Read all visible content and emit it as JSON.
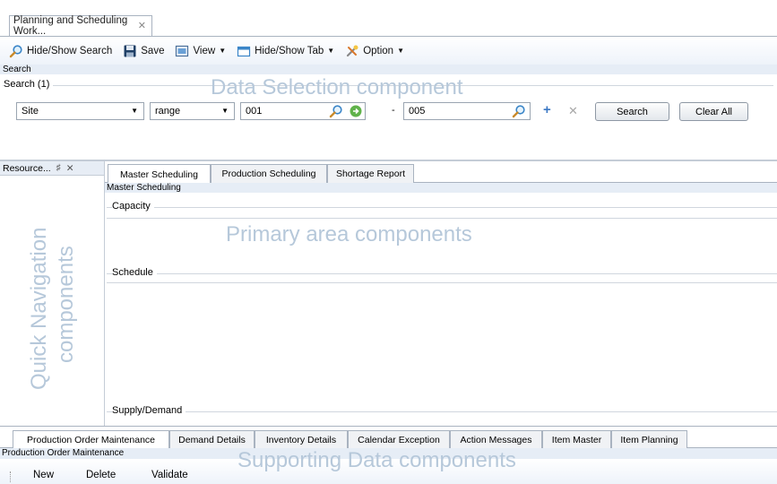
{
  "document_tab": {
    "title": "Planning and Scheduling Work...",
    "close_glyph": "✕"
  },
  "toolbar": {
    "items": [
      {
        "label": "Hide/Show Search",
        "icon": "magnifier-icon"
      },
      {
        "label": "Save",
        "icon": "floppy-disk-icon"
      },
      {
        "label": "View",
        "icon": "view-icon",
        "dropdown": true
      },
      {
        "label": "Hide/Show Tab",
        "icon": "tab-icon",
        "dropdown": true
      },
      {
        "label": "Option",
        "icon": "tools-icon",
        "dropdown": true
      }
    ]
  },
  "search": {
    "strip_label": "Search",
    "group_label": "Search (1)",
    "overlay": "Data Selection component",
    "field_select": "Site",
    "operator_select": "range",
    "from_value": "001",
    "dash": "-",
    "to_value": "005",
    "add_glyph": "+",
    "remove_glyph": "✕",
    "search_button": "Search",
    "clear_button": "Clear All"
  },
  "side_panel": {
    "title": "Resource...",
    "pin_glyph": "♯",
    "close_glyph": "✕",
    "overlay_line1": "Quick Navigation",
    "overlay_line2": "components"
  },
  "main": {
    "tabs": [
      "Master Scheduling",
      "Production Scheduling",
      "Shortage Report"
    ],
    "active_tab": "Master Scheduling",
    "strip_label": "Master Scheduling",
    "capacity_label": "Capacity",
    "overlay": "Primary area components",
    "schedule_label": "Schedule",
    "supply_demand_label": "Supply/Demand"
  },
  "bottom": {
    "tabs": [
      "Production Order Maintenance",
      "Demand Details",
      "Inventory Details",
      "Calendar Exception",
      "Action Messages",
      "Item Master",
      "Item Planning"
    ],
    "active_tab": "Production Order Maintenance",
    "strip_label": "Production Order Maintenance",
    "overlay": "Supporting Data components",
    "actions": [
      "New",
      "Delete",
      "Validate"
    ]
  },
  "colors": {
    "overlay_text": "#b6c8da",
    "accent_blue": "#3b78c4",
    "strip_background": "#e6edf6"
  }
}
